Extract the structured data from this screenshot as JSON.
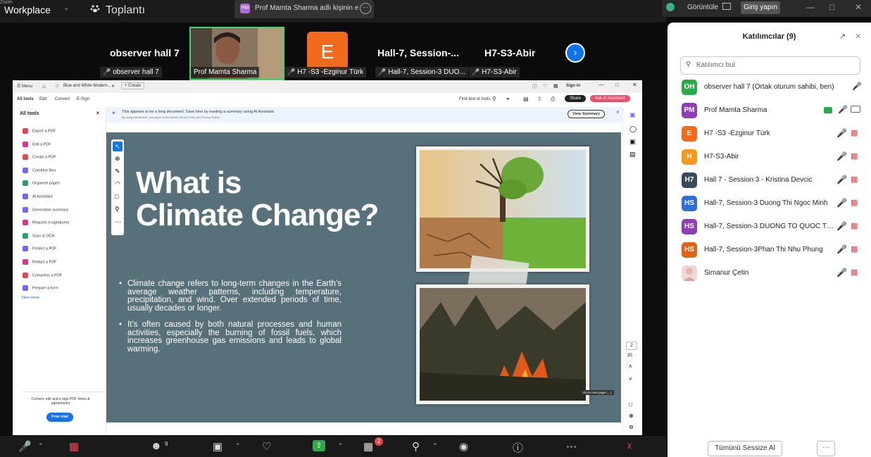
{
  "app": {
    "brand": "Workplace",
    "brand_sup": "Zoom"
  },
  "topbar": {
    "meeting_title": "Toplantı",
    "share_badge": "PM",
    "share_title": "Prof Mamta Sharma adlı kişinin e",
    "view_label": "Görüntüle",
    "join_label": "Giriş yapın"
  },
  "video_strip": {
    "tiles": [
      {
        "big_name": "observer hall 7",
        "label": "observer hall 7"
      },
      {
        "label": "Prof Mamta Sharma"
      },
      {
        "avatar": "E",
        "label": "H7 -S3 -Ezginur Türk"
      },
      {
        "big_name": "Hall-7, Session-...",
        "label": "Hall-7, Session-3 DUO..."
      },
      {
        "big_name": "H7-S3-Abir",
        "label": "H7-S3-Abir"
      }
    ]
  },
  "pdf_app": {
    "menu": "Menu",
    "tab_title": "Blue and White Modern...",
    "create": "Create",
    "sign_in": "Sign in",
    "nav": [
      "All tools",
      "Edit",
      "Convert",
      "E-Sign"
    ],
    "find": "Find text or tools",
    "share": "Share",
    "ask_ai": "Ask AI Assistant",
    "sidebar_title": "All tools",
    "tools": [
      "Export a PDF",
      "Edit a PDF",
      "Create a PDF",
      "Combine files",
      "Organize pages",
      "AI Assistant",
      "Generative summary",
      "Request e-signatures",
      "Scan & OCR",
      "Protect a PDF",
      "Redact a PDF",
      "Compress a PDF",
      "Prepare a form"
    ],
    "view_more": "View more",
    "promo": "Convert, edit and e-sign PDF forms & agreements",
    "free_trial": "Free trial",
    "banner_text": "This appears to be a long document. Save time by reading a summary using AI Assistant.",
    "banner_sub": "By using this service, you agree to the Adobe Terms of Use and Privacy Policy.",
    "view_summary": "View Summary",
    "page_current": "2",
    "page_total": "20",
    "tooltip": "Go to next page (→)"
  },
  "slide": {
    "title_line1": "What is",
    "title_line2": "Climate Change?",
    "bullets": [
      "Climate change refers to long-term changes in the Earth’s average weather patterns, including temperature, precipitation, and wind. Over extended periods of time, usually decades or longer.",
      "It’s often caused by both natural processes and human activities, especially the burning of fossil fuels, which increases greenhouse gas emissions and leads to global warming."
    ]
  },
  "participants": {
    "title": "Katılımcılar (9)",
    "search_placeholder": "Katılımcı bul",
    "list": [
      {
        "initials": "OH",
        "color": "#2ea84a",
        "name": "observer hall 7 (Ortak oturum sahibi, ben)"
      },
      {
        "initials": "PM",
        "color": "#8e3fb8",
        "name": "Prof Mamta Sharma"
      },
      {
        "initials": "E",
        "color": "#f26b1d",
        "name": "H7 -S3 -Ezginur Türk"
      },
      {
        "initials": "H",
        "color": "#f29a1d",
        "name": "H7-S3-Abir"
      },
      {
        "initials": "H7",
        "color": "#3b4a5a",
        "name": "Hall 7 - Session 3 - Kristina Devcic"
      },
      {
        "initials": "HS",
        "color": "#2f6fd6",
        "name": "Hall-7, Session-3 Duong Thi Ngoc Minh"
      },
      {
        "initials": "HS",
        "color": "#8e3fb8",
        "name": "Hall-7, Session-3 DUONG TO QUOC TH..."
      },
      {
        "initials": "HS",
        "color": "#e0641c",
        "name": "Hall-7, Session-3Phan Thi Nhu Phung"
      },
      {
        "initials": "",
        "color": "#f3d6d6",
        "name": "Simanur Çetin"
      }
    ],
    "mute_all": "Tümünü Sessize Al",
    "more": "···"
  },
  "bottom_bar": {
    "participants_count": "9",
    "apps_badge": "2"
  }
}
